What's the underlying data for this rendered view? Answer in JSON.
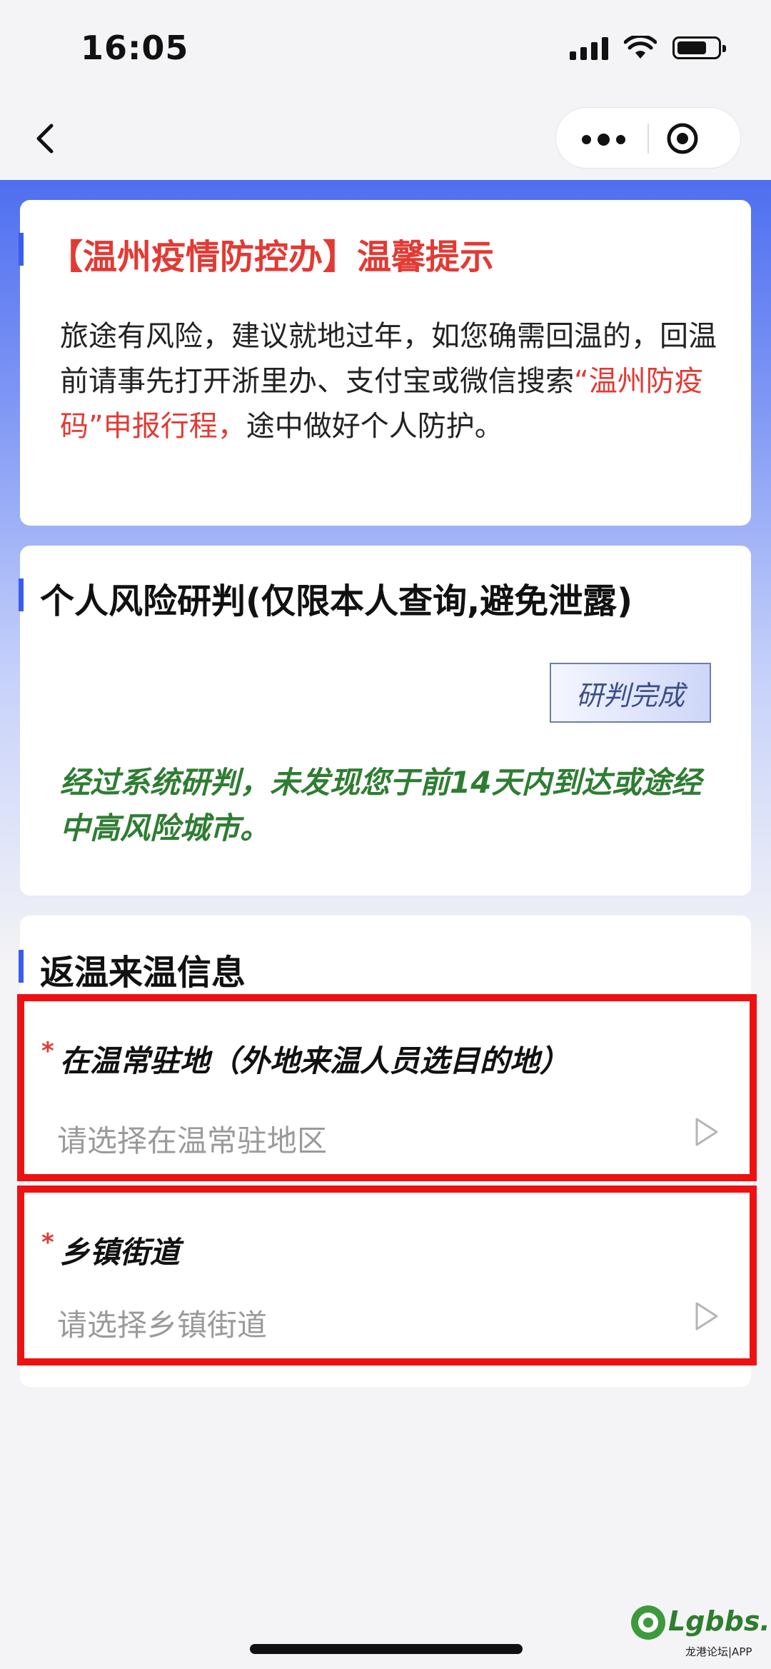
{
  "status_bar": {
    "time": "16:05"
  },
  "notice": {
    "title": "【温州疫情防控办】温馨提示",
    "body_part1": "旅途有风险，建议就地过年，如您确需回温的，回温前请事先打开浙里办、支付宝或微信搜索",
    "body_highlight": "“温州防疫码”申报行程，",
    "body_part2": "途中做好个人防护。"
  },
  "risk": {
    "title": "个人风险研判(仅限本人查询,避免泄露)",
    "status_button": "研判完成",
    "result": "经过系统研判，未发现您于前14天内到达或途经中高风险城市。"
  },
  "return_info": {
    "title": "返温来温信息",
    "residence": {
      "required_mark": "*",
      "label": "在温常驻地（外地来温人员选目的地）",
      "placeholder": "请选择在温常驻地区"
    },
    "street": {
      "required_mark": "*",
      "label": "乡镇街道",
      "placeholder": "请选择乡镇街道"
    }
  },
  "watermark": {
    "text": "Lgbbs.cn",
    "subtext": "龙港论坛|APP"
  },
  "colors": {
    "accent_blue": "#3b5cf0",
    "alert_red": "#e23a34",
    "result_green": "#2e7d32",
    "highlight_border": "#ee1111"
  }
}
